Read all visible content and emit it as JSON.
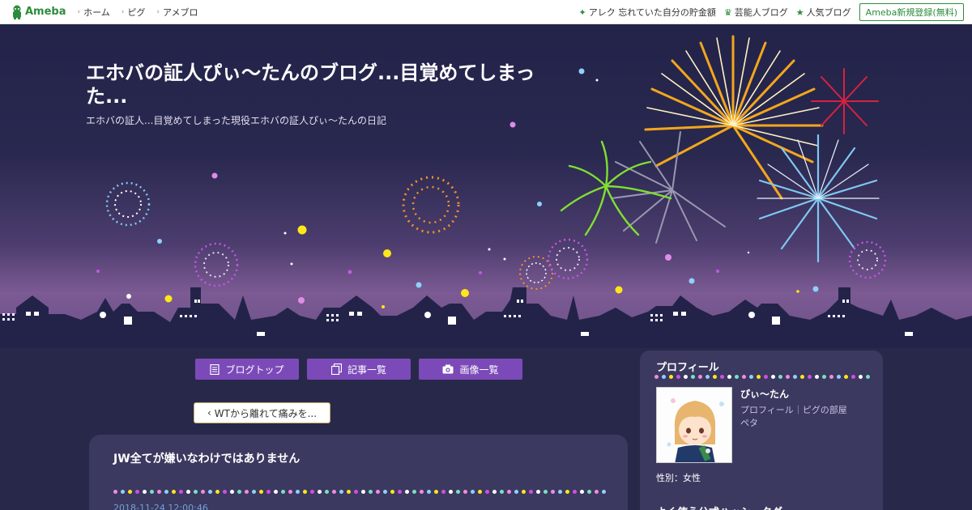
{
  "topbar": {
    "logo_text": "Ameba",
    "nav": [
      "ホーム",
      "ピグ",
      "アメブロ"
    ],
    "promo_link": "アレク 忘れていた自分の貯金額",
    "celebrity_link": "芸能人ブログ",
    "popular_link": "人気ブログ",
    "register_label": "Ameba新規登録(無料)",
    "icons": {
      "promo": "sparkle-icon",
      "celebrity": "crown-icon",
      "popular": "star-icon"
    }
  },
  "header": {
    "title": "エホバの証人ぴぃ～たんのブログ...目覚めてしまった...",
    "description": "エホバの証人...目覚めてしまった現役エホバの証人ぴぃ～たんの日記"
  },
  "tabs": [
    {
      "label": "ブログトップ",
      "icon": "document-icon"
    },
    {
      "label": "記事一覧",
      "icon": "copy-icon"
    },
    {
      "label": "画像一覧",
      "icon": "camera-icon"
    }
  ],
  "prev_article_label": "WTから離れて痛みを...",
  "article": {
    "title": "JW全てが嫌いなわけではありません",
    "date": "2018-11-24 12:00:46"
  },
  "profile": {
    "heading": "プロフィール",
    "name": "ぴぃ～たん",
    "link_profile": "プロフィール",
    "link_separator": "｜",
    "link_pigg": "ピグの部屋",
    "peta": "ペタ",
    "gender": "性別：女性",
    "tags_heading": "よく使う公式ハッシュタグ"
  },
  "colors": {
    "accent": "#7b4ab8",
    "ameba_green": "#2d8c3c",
    "panel": "#3b3960",
    "page_bg": "#28294a"
  }
}
